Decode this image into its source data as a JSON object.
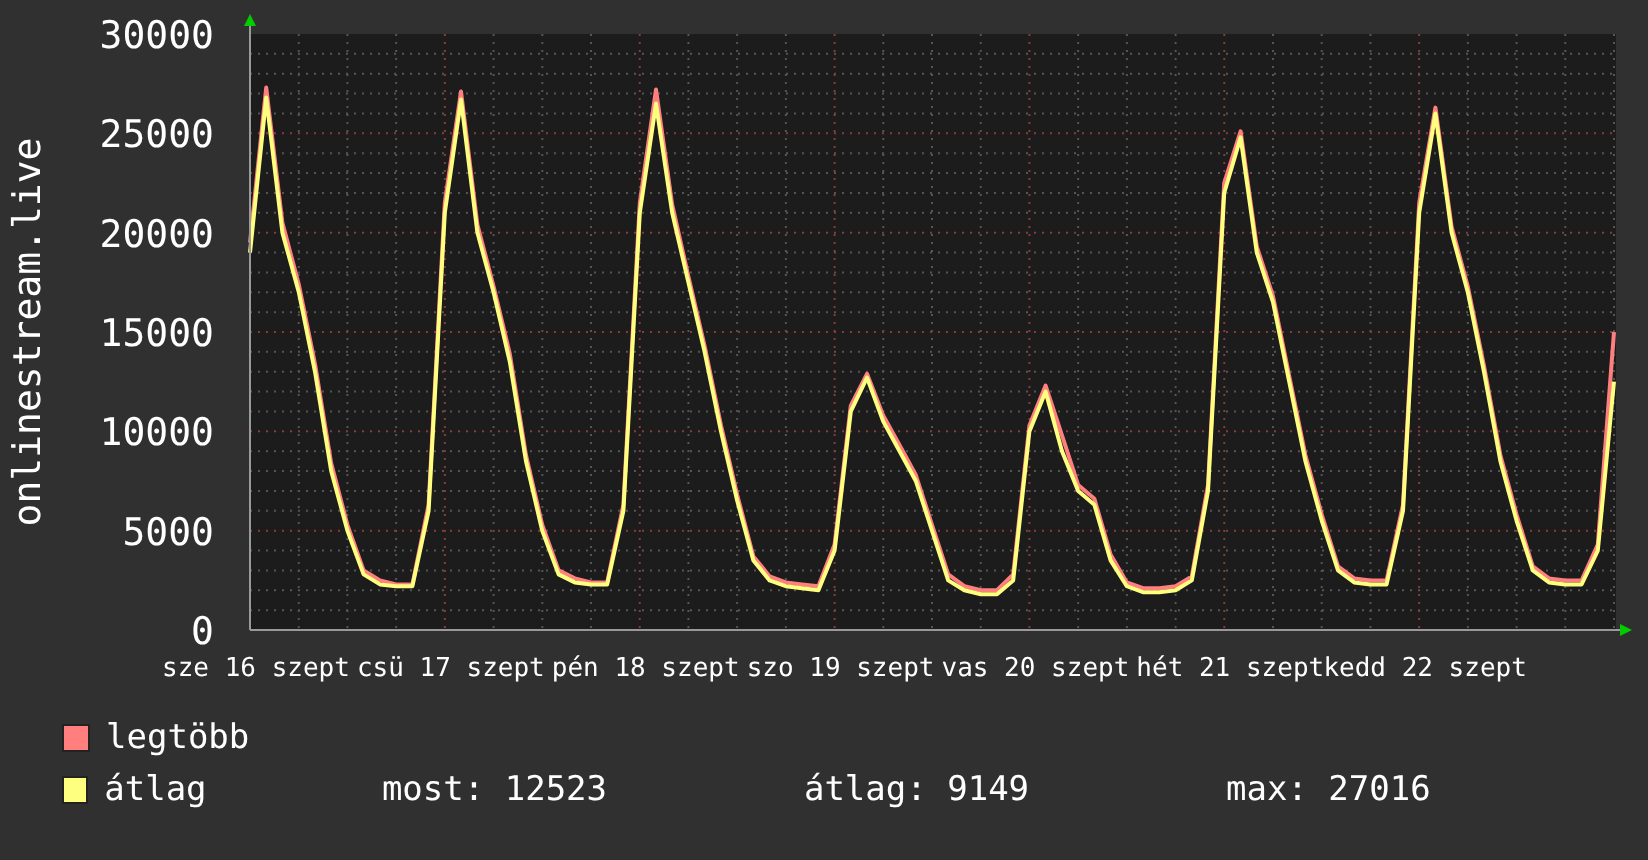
{
  "chart": {
    "chart_data": {
      "type": "line",
      "ylabel": "onlinestream.live",
      "categories": [
        "sze 16 szept",
        null,
        null,
        null,
        null,
        null,
        null,
        null,
        null,
        null,
        null,
        null,
        "csü 17 szept",
        null,
        null,
        null,
        null,
        null,
        null,
        null,
        null,
        null,
        null,
        null,
        "pén 18 szept",
        null,
        null,
        null,
        null,
        null,
        null,
        null,
        null,
        null,
        null,
        null,
        "szo 19 szept",
        null,
        null,
        null,
        null,
        null,
        null,
        null,
        null,
        null,
        null,
        null,
        "vas 20 szept",
        null,
        null,
        null,
        null,
        null,
        null,
        null,
        null,
        null,
        null,
        null,
        "hét 21 szept",
        null,
        null,
        null,
        null,
        null,
        null,
        null,
        null,
        null,
        null,
        null,
        "kedd 22 szept",
        null,
        null,
        null,
        null,
        null,
        null,
        null,
        null,
        null,
        null,
        null,
        null
      ],
      "series": [
        {
          "name": "legtöbb",
          "color": "#ff7f7f",
          "values": [
            19500,
            27300,
            20500,
            17400,
            13400,
            8400,
            5300,
            3000,
            2500,
            2300,
            2300,
            6300,
            21500,
            27100,
            20400,
            17300,
            13900,
            8800,
            5300,
            3000,
            2600,
            2400,
            2400,
            6300,
            21500,
            27200,
            21400,
            17800,
            14300,
            10300,
            6800,
            3700,
            2700,
            2400,
            2300,
            2200,
            4300,
            11300,
            12900,
            10800,
            9300,
            7800,
            5300,
            2800,
            2200,
            2000,
            2000,
            2800,
            10300,
            12300,
            9800,
            7300,
            6600,
            3800,
            2400,
            2100,
            2100,
            2200,
            2700,
            7300,
            22500,
            25100,
            19300,
            16800,
            12800,
            8800,
            5800,
            3200,
            2600,
            2500,
            2500,
            6300,
            21500,
            26300,
            20300,
            17300,
            13300,
            8800,
            5800,
            3200,
            2600,
            2500,
            2500,
            4300,
            15000
          ]
        },
        {
          "name": "átlag",
          "color": "#ffff7f",
          "values": [
            19000,
            26800,
            20000,
            17000,
            13000,
            8000,
            5000,
            2800,
            2300,
            2200,
            2200,
            6000,
            21000,
            26700,
            20000,
            17000,
            13500,
            8500,
            5000,
            2800,
            2400,
            2300,
            2300,
            6000,
            21000,
            26500,
            21000,
            17500,
            14000,
            10000,
            6500,
            3500,
            2500,
            2200,
            2100,
            2000,
            4000,
            11000,
            12700,
            10500,
            9000,
            7500,
            5000,
            2500,
            2000,
            1800,
            1800,
            2500,
            10000,
            12000,
            9000,
            7000,
            6300,
            3500,
            2200,
            1900,
            1900,
            2000,
            2500,
            7000,
            22000,
            24800,
            19000,
            16500,
            12500,
            8500,
            5500,
            3000,
            2400,
            2300,
            2300,
            6000,
            21000,
            26000,
            20000,
            17000,
            13000,
            8500,
            5500,
            3000,
            2400,
            2300,
            2300,
            4000,
            12500
          ]
        }
      ],
      "grid": true,
      "ylim": [
        0,
        30000
      ],
      "yticks": [
        0,
        5000,
        10000,
        15000,
        20000,
        25000,
        30000
      ]
    }
  },
  "legend": {
    "stats": [
      "most: 12523",
      "átlag: 9149",
      "max: 27016"
    ]
  }
}
